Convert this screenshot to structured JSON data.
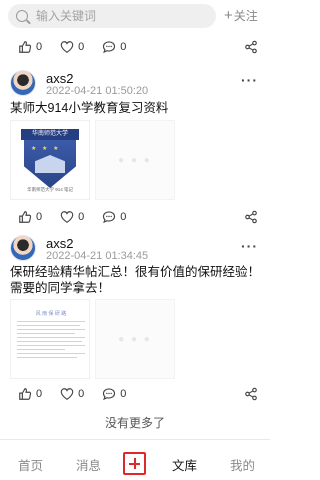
{
  "search": {
    "placeholder": "输入关键词"
  },
  "header": {
    "follow_label": "关注",
    "follow_prefix": "+"
  },
  "top_actions": {
    "like_count": "0",
    "favorite_count": "0",
    "comment_count": "0"
  },
  "posts": [
    {
      "username": "axs2",
      "time": "2022-04-21 01:50:20",
      "text": "某师大914小学教育复习资料",
      "thumb_caption": "华南师范大学 914 笔记",
      "crest_band_text": "华南师范大学",
      "like_count": "0",
      "favorite_count": "0",
      "comment_count": "0"
    },
    {
      "username": "axs2",
      "time": "2022-04-21 01:34:45",
      "text": "保研经验精华帖汇总！很有价值的保研经验！需要的同学拿去！",
      "doc_title": "风 雨 保 研 路",
      "like_count": "0",
      "favorite_count": "0",
      "comment_count": "0"
    }
  ],
  "footer": {
    "no_more": "没有更多了"
  },
  "tabbar": {
    "tabs": [
      {
        "label": "首页"
      },
      {
        "label": "消息"
      },
      {
        "label": "文库"
      },
      {
        "label": "我的"
      }
    ]
  },
  "colors": {
    "accent": "#e02828",
    "text_muted": "#9a9a9a"
  },
  "icons": [
    "search-icon",
    "plus-icon",
    "like-icon",
    "heart-icon",
    "comment-icon",
    "share-icon",
    "more-icon",
    "add-tab-icon"
  ]
}
